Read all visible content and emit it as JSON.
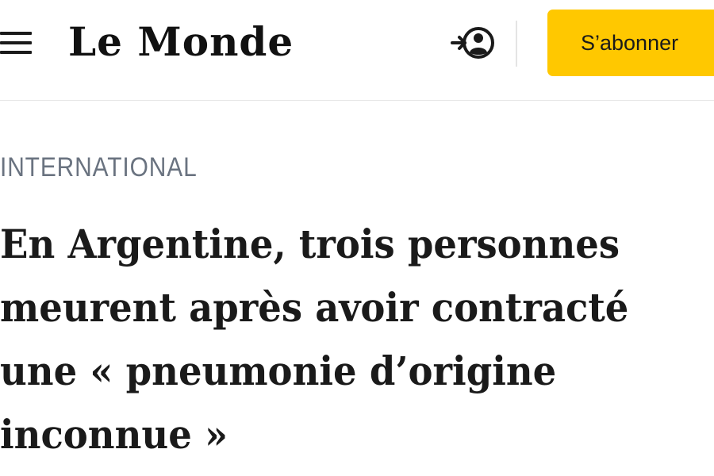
{
  "header": {
    "logo_text": "Le Monde",
    "account_icon": "login-user-icon",
    "menu_icon": "hamburger-menu-icon",
    "subscribe_label": "S’abonner",
    "subscribe_color": "#ffc800"
  },
  "article": {
    "section": "INTERNATIONAL",
    "headline_lines": [
      "En Argentine, trois personnes",
      "meurent après avoir contracté",
      "une « pneumonie d’origine",
      "inconnue »"
    ]
  },
  "colors": {
    "section_text": "#6a7380",
    "headline_text": "#1a1a1a",
    "background": "#ffffff"
  }
}
